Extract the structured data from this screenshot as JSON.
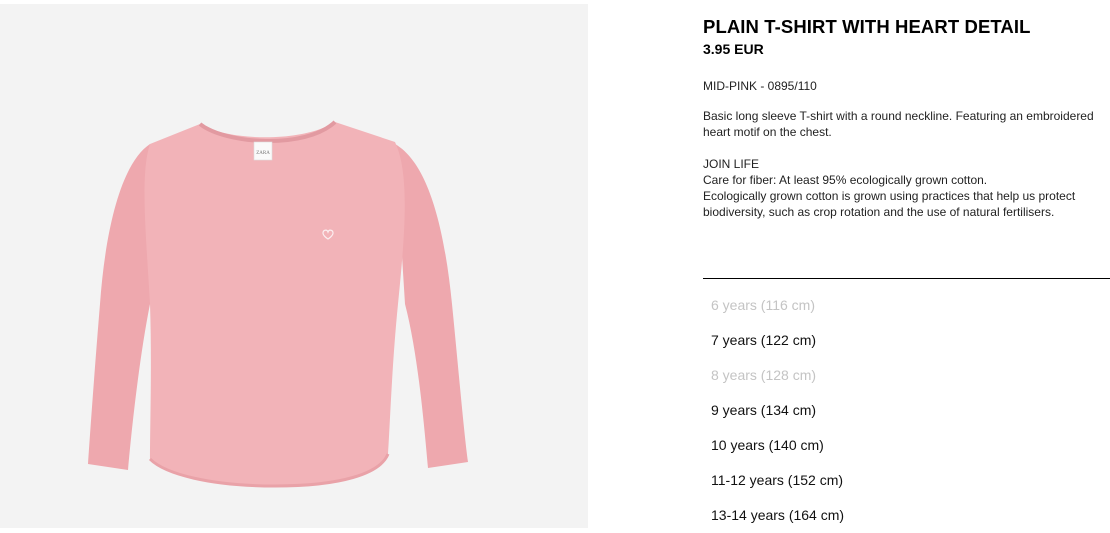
{
  "product": {
    "title": "PLAIN T-SHIRT WITH HEART DETAIL",
    "price": "3.95 EUR",
    "color_ref": "MID-PINK - 0895/110",
    "description": "Basic long sleeve T-shirt with a round neckline. Featuring an embroidered heart motif on the chest.",
    "join_life": {
      "heading": "JOIN LIFE",
      "line1": "Care for fiber: At least 95% ecologically grown cotton.",
      "line2": "Ecologically grown cotton is grown using practices that help us protect biodiversity, such as crop rotation and the use of natural fertilisers."
    },
    "label_text": "ZARA"
  },
  "sizes": [
    {
      "label": "6 years (116 cm)",
      "available": false
    },
    {
      "label": "7 years (122 cm)",
      "available": true
    },
    {
      "label": "8 years (128 cm)",
      "available": false
    },
    {
      "label": "9 years (134 cm)",
      "available": true
    },
    {
      "label": "10 years (140 cm)",
      "available": true
    },
    {
      "label": "11-12 years (152 cm)",
      "available": true
    },
    {
      "label": "13-14 years (164 cm)",
      "available": true
    }
  ],
  "colors": {
    "shirt": "#f2b3b8",
    "shirt_shadow": "#e9a2a8",
    "background": "#f3f3f3",
    "unavailable_text": "#c4c4c4"
  }
}
